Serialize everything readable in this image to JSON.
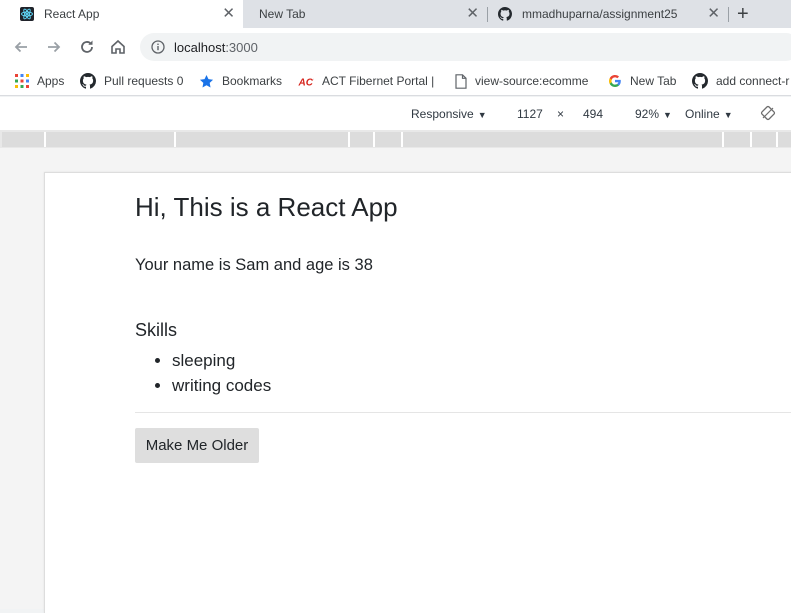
{
  "browser": {
    "tabs": [
      {
        "title": "React App",
        "active": true
      },
      {
        "title": "New Tab",
        "active": false
      },
      {
        "title": "mmadhuparna/assignment25",
        "active": false
      }
    ],
    "address": {
      "host": "localhost",
      "port": ":3000"
    },
    "bookmarks": [
      {
        "label": "Apps",
        "icon": "apps-grid-icon"
      },
      {
        "label": "Pull requests 0",
        "icon": "github-icon"
      },
      {
        "label": "Bookmarks",
        "icon": "star-icon"
      },
      {
        "label": "ACT Fibernet Portal |",
        "icon": "act-logo-icon"
      },
      {
        "label": "view-source:ecomme",
        "icon": "page-icon"
      },
      {
        "label": "New Tab",
        "icon": "google-icon"
      },
      {
        "label": "add connect-r",
        "icon": "github-icon"
      }
    ]
  },
  "devtools": {
    "device": "Responsive",
    "width": "1127",
    "times": "×",
    "height": "494",
    "zoom": "92%",
    "network": "Online"
  },
  "app": {
    "title": "Hi, This is a React App",
    "intro": "Your name is Sam and age is 38",
    "skills_heading": "Skills",
    "skills": [
      "sleeping",
      "writing codes"
    ],
    "button_label": "Make Me Older"
  },
  "colors": {
    "tabstrip": "#dee1e6",
    "button_bg": "#dedede",
    "text": "#212529"
  }
}
